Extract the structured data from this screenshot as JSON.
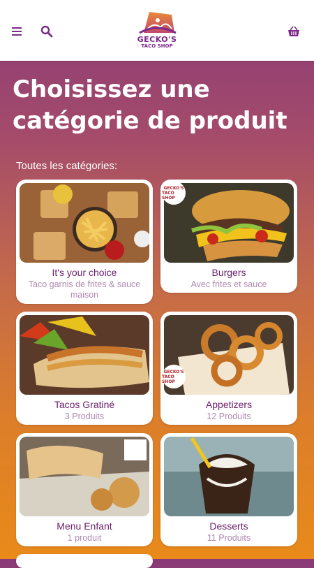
{
  "header": {
    "logo_line1": "GECKO'S",
    "logo_line2": "TACO SHOP"
  },
  "page_title": "Choisissez une\ncatégorie de produit",
  "section_label": "Toutes les catégories:",
  "colors": {
    "brand_purple": "#7d2a8a",
    "gradient_top": "#8a3a78",
    "gradient_bottom": "#e98a1a",
    "subtitle": "#b088b0"
  },
  "categories": [
    {
      "title": "It's your choice",
      "subtitle": "Taco garnis de frites & sauce maison"
    },
    {
      "title": "Burgers",
      "subtitle": "Avec frites et sauce"
    },
    {
      "title": "Tacos Gratiné",
      "subtitle": "3 Produits"
    },
    {
      "title": "Appetizers",
      "subtitle": "12 Produits"
    },
    {
      "title": "Menu Enfant",
      "subtitle": "1 produit"
    },
    {
      "title": "Desserts",
      "subtitle": "11 Produits"
    }
  ],
  "badge": {
    "line1": "GECKO'S",
    "line2": "TACO SHOP"
  }
}
